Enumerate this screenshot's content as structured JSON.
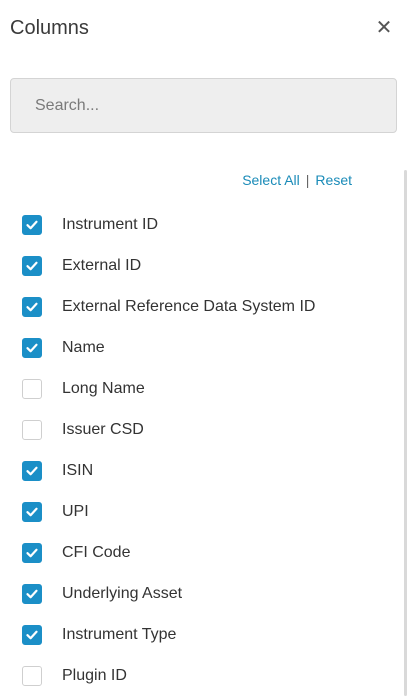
{
  "header": {
    "title": "Columns",
    "close_glyph": "✕"
  },
  "search": {
    "value": "",
    "placeholder": "Search..."
  },
  "actions": {
    "select_all": "Select All",
    "separator": "|",
    "reset": "Reset"
  },
  "colors": {
    "checkbox_checked": "#1b8fc7",
    "link": "#1a8bb8"
  },
  "columns": [
    {
      "label": "Instrument ID",
      "checked": true
    },
    {
      "label": "External ID",
      "checked": true
    },
    {
      "label": "External Reference Data System ID",
      "checked": true
    },
    {
      "label": "Name",
      "checked": true
    },
    {
      "label": "Long Name",
      "checked": false
    },
    {
      "label": "Issuer CSD",
      "checked": false
    },
    {
      "label": "ISIN",
      "checked": true
    },
    {
      "label": "UPI",
      "checked": true
    },
    {
      "label": "CFI Code",
      "checked": true
    },
    {
      "label": "Underlying Asset",
      "checked": true
    },
    {
      "label": "Instrument Type",
      "checked": true
    },
    {
      "label": "Plugin ID",
      "checked": false
    }
  ]
}
